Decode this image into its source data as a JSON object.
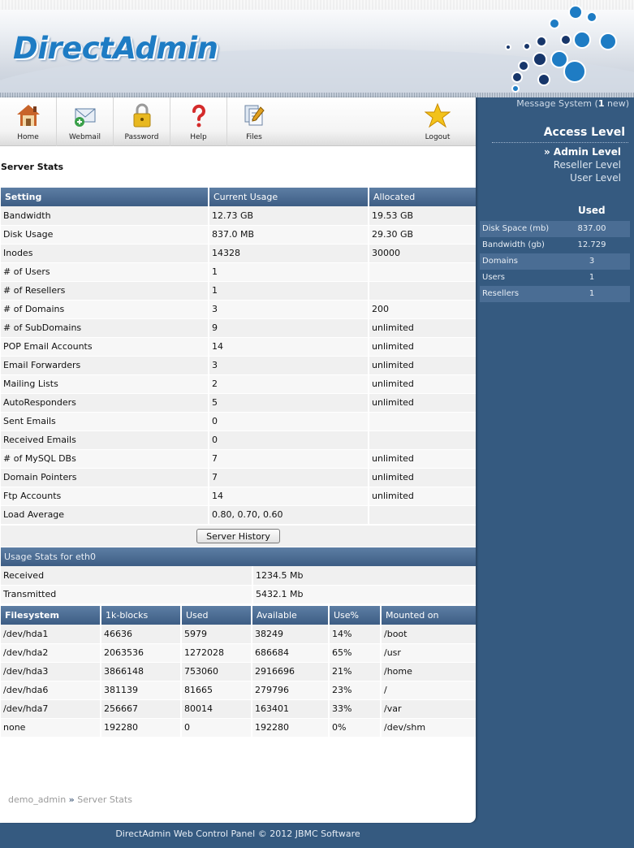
{
  "header": {
    "logo_text": "DirectAdmin"
  },
  "message_system": {
    "label_pre": "Message System (",
    "count": "1",
    "label_post": " new)"
  },
  "toolbar": {
    "items": [
      {
        "label": "Home",
        "icon": "house-icon"
      },
      {
        "label": "Webmail",
        "icon": "envelope-icon"
      },
      {
        "label": "Password",
        "icon": "padlock-icon"
      },
      {
        "label": "Help",
        "icon": "question-mark-icon"
      },
      {
        "label": "Files",
        "icon": "files-icon"
      },
      {
        "label": "Logout",
        "icon": "star-icon"
      }
    ]
  },
  "page_title": "Server Stats",
  "stats": {
    "headers": [
      "Setting",
      "Current Usage",
      "Allocated"
    ],
    "rows": [
      [
        "Bandwidth",
        "12.73 GB",
        "19.53 GB"
      ],
      [
        "Disk Usage",
        "837.0 MB",
        "29.30 GB"
      ],
      [
        "Inodes",
        "14328",
        "30000"
      ],
      [
        "# of Users",
        "1",
        ""
      ],
      [
        "# of Resellers",
        "1",
        ""
      ],
      [
        "# of Domains",
        "3",
        "200"
      ],
      [
        "# of SubDomains",
        "9",
        "unlimited"
      ],
      [
        "POP Email Accounts",
        "14",
        "unlimited"
      ],
      [
        "Email Forwarders",
        "3",
        "unlimited"
      ],
      [
        "Mailing Lists",
        "2",
        "unlimited"
      ],
      [
        "AutoResponders",
        "5",
        "unlimited"
      ],
      [
        "Sent Emails",
        "0",
        ""
      ],
      [
        "Received Emails",
        "0",
        ""
      ],
      [
        "# of MySQL DBs",
        "7",
        "unlimited"
      ],
      [
        "Domain Pointers",
        "7",
        "unlimited"
      ],
      [
        "Ftp Accounts",
        "14",
        "unlimited"
      ],
      [
        "Load Average",
        "0.80, 0.70, 0.60",
        ""
      ]
    ],
    "server_history_button": "Server History"
  },
  "eth": {
    "title": "Usage Stats for eth0",
    "rows": [
      [
        "Received",
        "1234.5 Mb"
      ],
      [
        "Transmitted",
        "5432.1 Mb"
      ]
    ]
  },
  "filesystem": {
    "headers": [
      "Filesystem",
      "1k-blocks",
      "Used",
      "Available",
      "Use%",
      "Mounted on"
    ],
    "rows": [
      [
        "/dev/hda1",
        "46636",
        "5979",
        "38249",
        "14%",
        "/boot"
      ],
      [
        "/dev/hda2",
        "2063536",
        "1272028",
        "686684",
        "65%",
        "/usr"
      ],
      [
        "/dev/hda3",
        "3866148",
        "753060",
        "2916696",
        "21%",
        "/home"
      ],
      [
        "/dev/hda6",
        "381139",
        "81665",
        "279796",
        "23%",
        "/"
      ],
      [
        "/dev/hda7",
        "256667",
        "80014",
        "163401",
        "33%",
        "/var"
      ],
      [
        "none",
        "192280",
        "0",
        "192280",
        "0%",
        "/dev/shm"
      ]
    ]
  },
  "breadcrumb": {
    "user": "demo_admin",
    "separator": "»",
    "page": "Server Stats"
  },
  "sidebar": {
    "access_title": "Access Level",
    "levels": [
      {
        "label": "» Admin Level",
        "active": true
      },
      {
        "label": "Reseller Level",
        "active": false
      },
      {
        "label": "User Level",
        "active": false
      }
    ],
    "used_header": "Used",
    "usage": [
      [
        "Disk Space (mb)",
        "837.00"
      ],
      [
        "Bandwidth (gb)",
        "12.729"
      ],
      [
        "Domains",
        "3"
      ],
      [
        "Users",
        "1"
      ],
      [
        "Resellers",
        "1"
      ]
    ]
  },
  "footer": {
    "text": "DirectAdmin Web Control Panel © 2012 JBMC Software"
  },
  "colors": {
    "brand_blue": "#1e7cc4",
    "sidebar_bg": "#355a80",
    "header_cell": "#4a6d94"
  }
}
